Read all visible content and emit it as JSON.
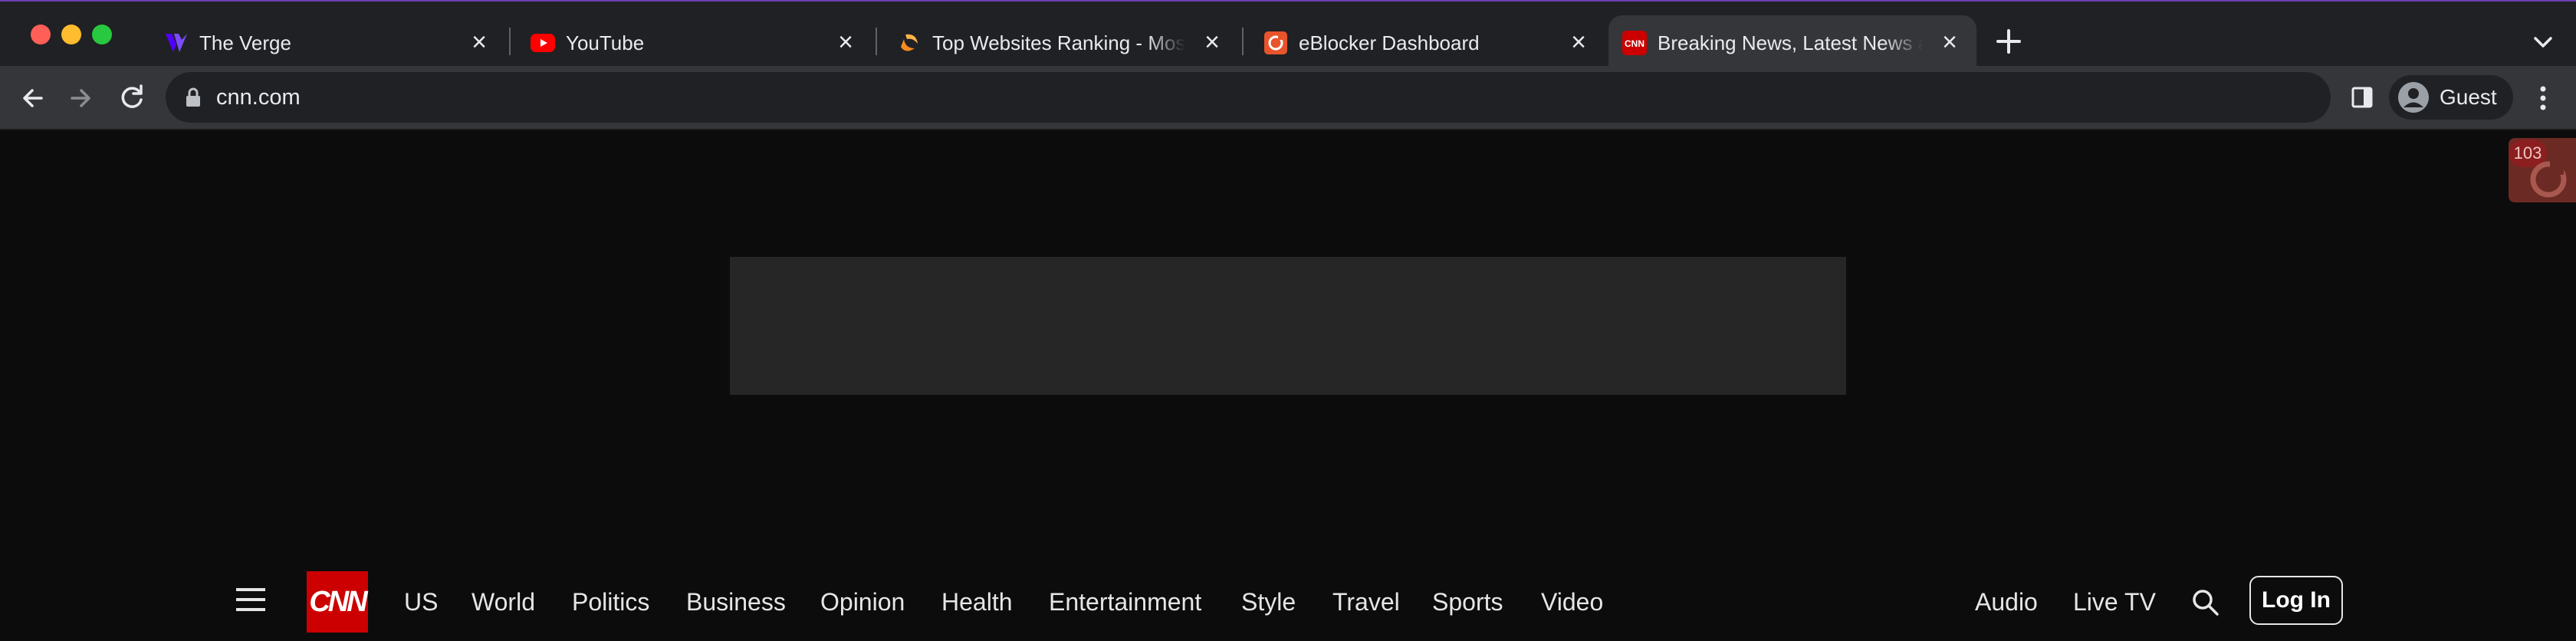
{
  "browser": {
    "tabs": [
      {
        "title": "The Verge",
        "icon": "verge-favicon-icon"
      },
      {
        "title": "YouTube",
        "icon": "youtube-favicon-icon"
      },
      {
        "title": "Top Websites Ranking - Most Visited Websites",
        "icon": "similarweb-favicon-icon"
      },
      {
        "title": "eBlocker Dashboard",
        "icon": "eblocker-favicon-icon"
      },
      {
        "title": "Breaking News, Latest News and Videos | CNN",
        "icon": "cnn-favicon-icon",
        "active": true
      }
    ],
    "url": "cnn.com",
    "profile_label": "Guest"
  },
  "extension": {
    "badge_count": "103",
    "accent": "#6b2a23"
  },
  "cnn": {
    "logo_text": "CNN",
    "nav_left": [
      "US",
      "World",
      "Politics",
      "Business",
      "Opinion",
      "Health",
      "Entertainment",
      "Style",
      "Travel",
      "Sports",
      "Video"
    ],
    "nav_right": [
      "Audio",
      "Live TV"
    ],
    "login_label": "Log In",
    "brand_color": "#cc0000"
  }
}
